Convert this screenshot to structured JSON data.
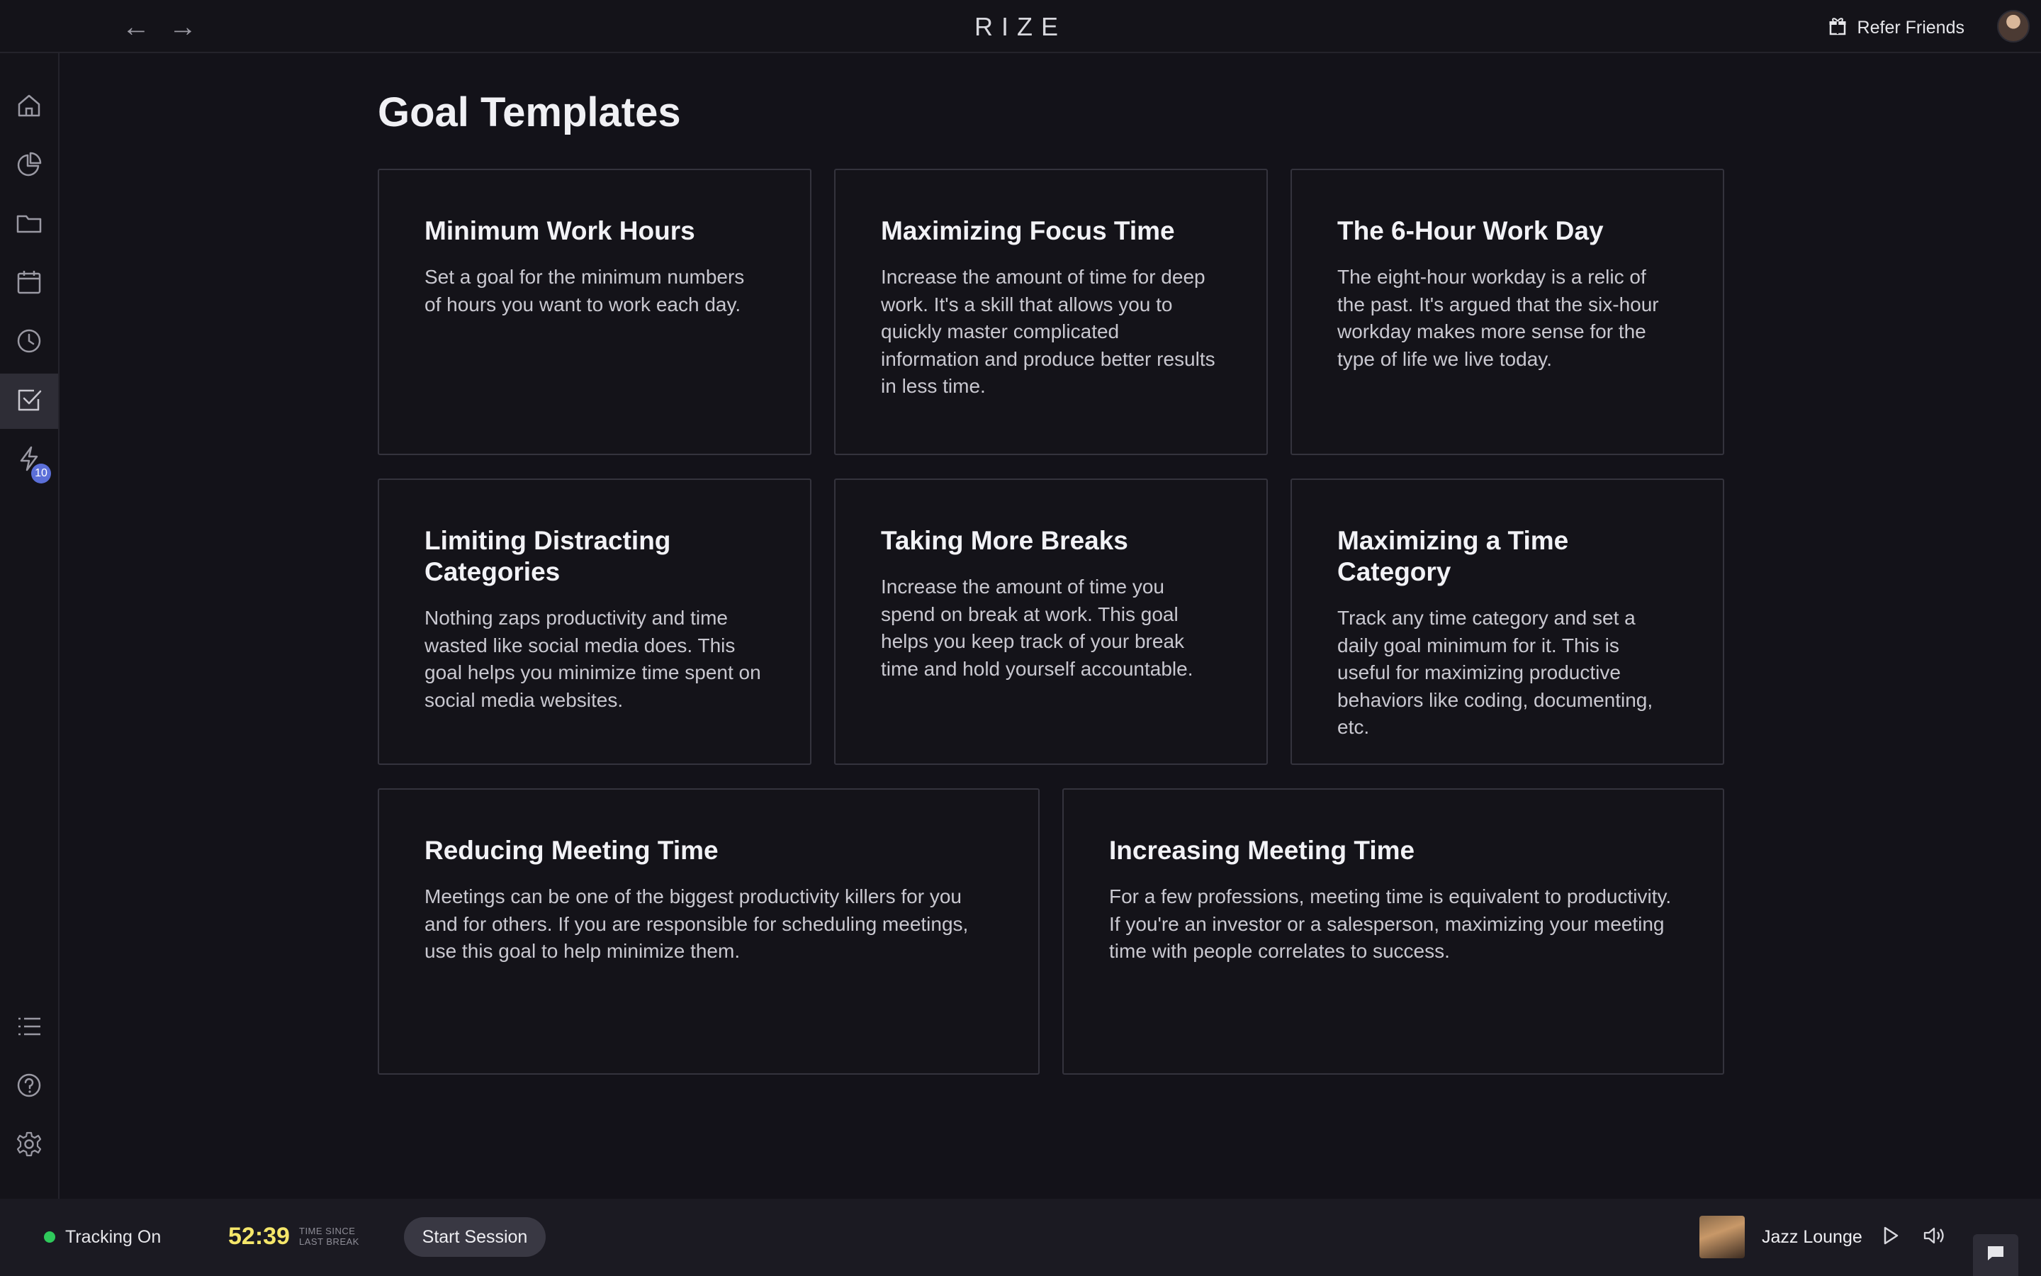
{
  "topbar": {
    "back_icon": "←",
    "forward_icon": "→",
    "logo": "RIZE",
    "refer_label": "Refer Friends"
  },
  "sidebar": {
    "items": [
      {
        "name": "home",
        "icon": "home-icon"
      },
      {
        "name": "analytics",
        "icon": "pie-chart-icon"
      },
      {
        "name": "projects",
        "icon": "folder-icon"
      },
      {
        "name": "calendar",
        "icon": "calendar-icon"
      },
      {
        "name": "history",
        "icon": "clock-icon"
      },
      {
        "name": "goals",
        "icon": "checkbox-icon",
        "active": true
      },
      {
        "name": "automations",
        "icon": "lightning-icon",
        "badge": "10"
      }
    ],
    "bottom_items": [
      {
        "name": "list",
        "icon": "list-icon"
      },
      {
        "name": "help",
        "icon": "help-icon"
      },
      {
        "name": "settings",
        "icon": "gear-icon"
      }
    ]
  },
  "main": {
    "title": "Goal Templates",
    "cards": [
      {
        "title": "Minimum Work Hours",
        "desc": "Set a goal for the minimum numbers of hours you want to work each day."
      },
      {
        "title": "Maximizing Focus Time",
        "desc": "Increase the amount of time for deep work. It's a skill that allows you to quickly master complicated information and produce better results in less time."
      },
      {
        "title": "The 6-Hour Work Day",
        "desc": "The eight-hour workday is a relic of the past. It's argued that the six-hour workday makes more sense for the type of life we live today."
      },
      {
        "title": "Limiting Distracting Categories",
        "desc": "Nothing zaps productivity and time wasted like social media does. This goal helps you minimize time spent on social media websites."
      },
      {
        "title": "Taking More Breaks",
        "desc": "Increase the amount of time you spend on break at work. This goal helps you keep track of your break time and hold yourself accountable."
      },
      {
        "title": "Maximizing a Time Category",
        "desc": "Track any time category and set a daily goal minimum for it. This is useful for maximizing productive behaviors like coding, documenting, etc."
      },
      {
        "title": "Reducing Meeting Time",
        "desc": "Meetings can be one of the biggest productivity killers for you and for others. If you are responsible for scheduling meetings, use this goal to help minimize them."
      },
      {
        "title": "Increasing Meeting Time",
        "desc": "For a few professions, meeting time is equivalent to productivity. If you're an investor or a salesperson, maximizing your meeting time with people correlates to success."
      }
    ]
  },
  "bottombar": {
    "tracking_label": "Tracking On",
    "status_color": "#2fc95b",
    "timer": "52:39",
    "timer_caption_line1": "TIME SINCE",
    "timer_caption_line2": "LAST BREAK",
    "start_session": "Start Session",
    "music_label": "Jazz Lounge"
  },
  "colors": {
    "background": "#131219",
    "accent_badge": "#5b6fd8",
    "timer": "#f5e66a"
  }
}
